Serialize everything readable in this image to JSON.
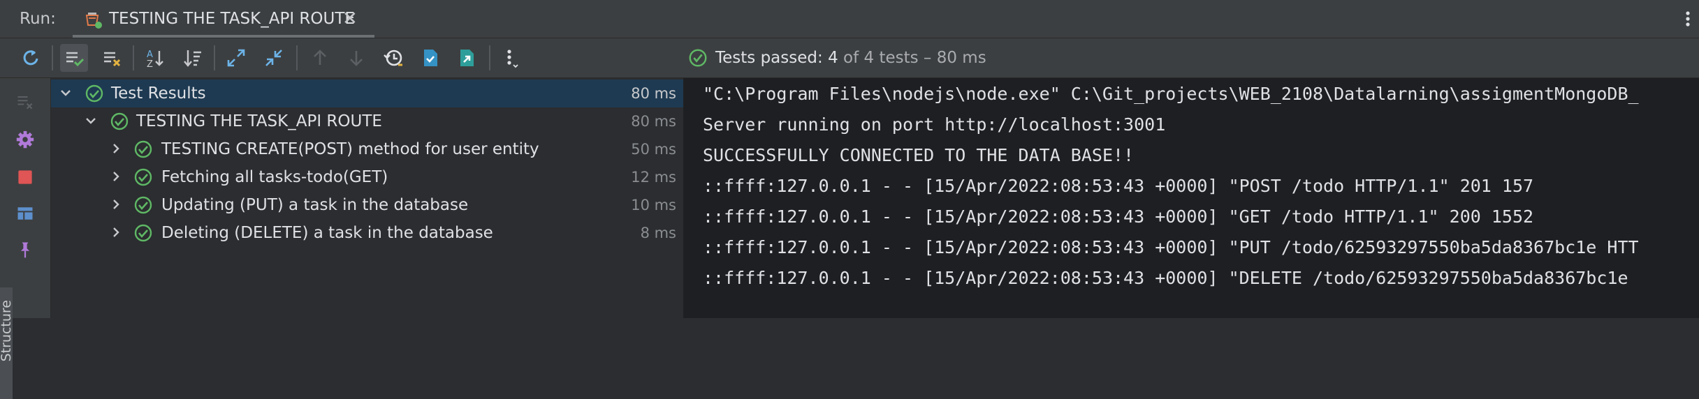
{
  "run_panel": {
    "label": "Run:",
    "tab": {
      "title": "TESTING THE TASK_API ROUTE",
      "icon": "test-run-icon",
      "close_glyph": "✕"
    }
  },
  "toolbar": {
    "buttons": [
      {
        "icon": "rerun-icon"
      },
      {
        "icon": "show-passed-icon",
        "active": true
      },
      {
        "icon": "show-ignored-icon"
      },
      {
        "icon": "sort-alphabetically-icon"
      },
      {
        "icon": "sort-by-duration-icon"
      },
      {
        "icon": "expand-all-icon"
      },
      {
        "icon": "collapse-all-icon"
      },
      {
        "icon": "previous-failed-icon",
        "enabled": false
      },
      {
        "icon": "next-failed-icon",
        "enabled": false
      },
      {
        "icon": "test-history-icon"
      },
      {
        "icon": "import-tests-icon"
      },
      {
        "icon": "export-tests-icon"
      },
      {
        "icon": "more-options-icon"
      }
    ],
    "status": {
      "prefix": "Tests passed: ",
      "passed": "4",
      "suffix": " of 4 tests – 80 ms"
    }
  },
  "left_toolbar": {
    "items": [
      "clear-icon",
      "settings-icon",
      "stop-icon",
      "layout-icon",
      "pin-icon"
    ],
    "structure_label": "Structure"
  },
  "test_tree": {
    "root": {
      "label": "Test Results",
      "time": "80 ms"
    },
    "suite": {
      "label": "TESTING THE TASK_API ROUTE",
      "time": "80 ms"
    },
    "tests": [
      {
        "label": "TESTING CREATE(POST) method for user entity",
        "time": "50 ms"
      },
      {
        "label": "Fetching all tasks-todo(GET)",
        "time": "12 ms"
      },
      {
        "label": "Updating (PUT) a task in the database",
        "time": "10 ms"
      },
      {
        "label": "Deleting (DELETE) a task in the database",
        "time": "8 ms"
      }
    ]
  },
  "console": {
    "lines": [
      "\"C:\\Program Files\\nodejs\\node.exe\" C:\\Git_projects\\WEB_2108\\Datalarning\\assigmentMongoDB_",
      "Server running on port http://localhost:3001",
      "SUCCESSFULLY CONNECTED TO THE DATA BASE!!",
      "::ffff:127.0.0.1 - - [15/Apr/2022:08:53:43 +0000] \"POST /todo HTTP/1.1\" 201 157",
      "::ffff:127.0.0.1 - - [15/Apr/2022:08:53:43 +0000] \"GET /todo HTTP/1.1\" 200 1552",
      "::ffff:127.0.0.1 - - [15/Apr/2022:08:53:43 +0000] \"PUT /todo/62593297550ba5da8367bc1e HTT",
      "::ffff:127.0.0.1 - - [15/Apr/2022:08:53:43 +0000] \"DELETE /todo/62593297550ba5da8367bc1e"
    ]
  },
  "colors": {
    "pass_green": "#5fb865",
    "accent_blue": "#3592c4",
    "stop_red": "#e05555",
    "settings_purple": "#b07ad9",
    "warning_yellow": "#e3b341",
    "selection_bg": "#1e3a52"
  }
}
